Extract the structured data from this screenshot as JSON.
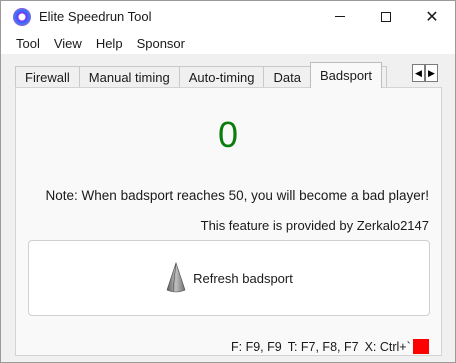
{
  "window": {
    "title": "Elite Speedrun Tool",
    "controls": {
      "minimize": "minimize",
      "maximize": "maximize",
      "close": "✕"
    }
  },
  "menu": [
    "Tool",
    "View",
    "Help",
    "Sponsor"
  ],
  "tabs": [
    {
      "label": "Firewall",
      "active": false
    },
    {
      "label": "Manual timing",
      "active": false
    },
    {
      "label": "Auto-timing",
      "active": false
    },
    {
      "label": "Data",
      "active": false
    },
    {
      "label": "Badsport",
      "active": true
    },
    {
      "label": "",
      "active": false
    }
  ],
  "tab_scroll": {
    "left": "◀",
    "right": "▶"
  },
  "badsport": {
    "count": "0",
    "count_color": "#0a7d0a",
    "note": "Note: When badsport reaches 50, you will become a bad player!",
    "credit": "This feature is provided by Zerkalo2147",
    "refresh_button": "Refresh badsport",
    "refresh_icon": "cone-icon"
  },
  "status": {
    "firewall_keys": "F: F9, F9",
    "timing_keys": "T: F7, F8, F7",
    "x_keys": "X: Ctrl+`",
    "indicator_color": "#ff0000"
  }
}
